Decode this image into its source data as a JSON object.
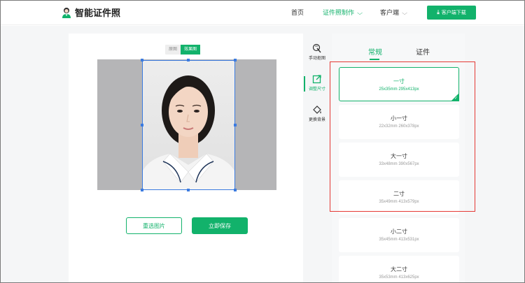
{
  "header": {
    "logo_text": "智能证件照",
    "nav": [
      {
        "label": "首页"
      },
      {
        "label": "证件照制作"
      },
      {
        "label": "客户端"
      }
    ],
    "download_label": "客户端下载",
    "accent_color": "#12b26b"
  },
  "editor": {
    "toggle": [
      "原图",
      "效果图"
    ],
    "active_toggle": "效果图",
    "reselect_label": "重选图片",
    "save_label": "立即保存"
  },
  "tools": [
    {
      "label": "手动抠图",
      "icon": "hand-cutout-icon"
    },
    {
      "label": "调整尺寸",
      "icon": "resize-icon",
      "active": true
    },
    {
      "label": "更换背景",
      "icon": "paint-bucket-icon"
    }
  ],
  "size_panel": {
    "tabs": [
      "常规",
      "证件"
    ],
    "active_tab": "常规",
    "sizes": [
      {
        "name": "一寸",
        "dims": "25x35mm 295x413px",
        "selected": true
      },
      {
        "name": "小一寸",
        "dims": "22x32mm 260x378px"
      },
      {
        "name": "大一寸",
        "dims": "33x48mm 390x567px"
      },
      {
        "name": "二寸",
        "dims": "35x49mm 413x579px"
      },
      {
        "name": "小二寸",
        "dims": "35x45mm 413x531px"
      },
      {
        "name": "大二寸",
        "dims": "35x53mm 413x625px"
      }
    ],
    "highlight_color": "#e53935"
  }
}
